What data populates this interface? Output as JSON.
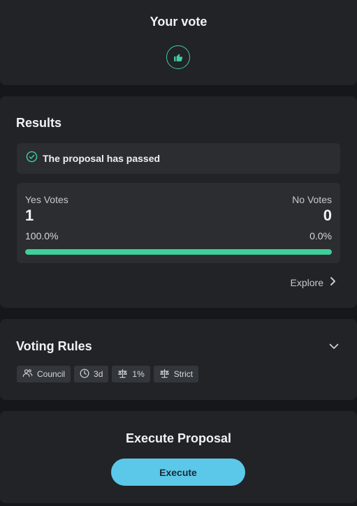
{
  "vote": {
    "title": "Your vote",
    "icon": "thumbs-up-icon"
  },
  "results": {
    "title": "Results",
    "status": {
      "icon": "check-circle-icon",
      "text": "The proposal has passed"
    },
    "yes": {
      "label": "Yes Votes",
      "count": "1",
      "percent": "100.0%"
    },
    "no": {
      "label": "No Votes",
      "count": "0",
      "percent": "0.0%"
    },
    "yes_fraction": 1.0,
    "explore_label": "Explore"
  },
  "rules": {
    "title": "Voting Rules",
    "pills": [
      {
        "icon": "users-icon",
        "label": "Council"
      },
      {
        "icon": "clock-icon",
        "label": "3d"
      },
      {
        "icon": "scale-icon",
        "label": "1%"
      },
      {
        "icon": "scale-icon",
        "label": "Strict"
      }
    ]
  },
  "execute": {
    "title": "Execute Proposal",
    "button_label": "Execute"
  },
  "colors": {
    "accent_green": "#3fcf9a",
    "accent_blue": "#5bc8ea",
    "card_bg": "#212326",
    "page_bg": "#15171a"
  }
}
